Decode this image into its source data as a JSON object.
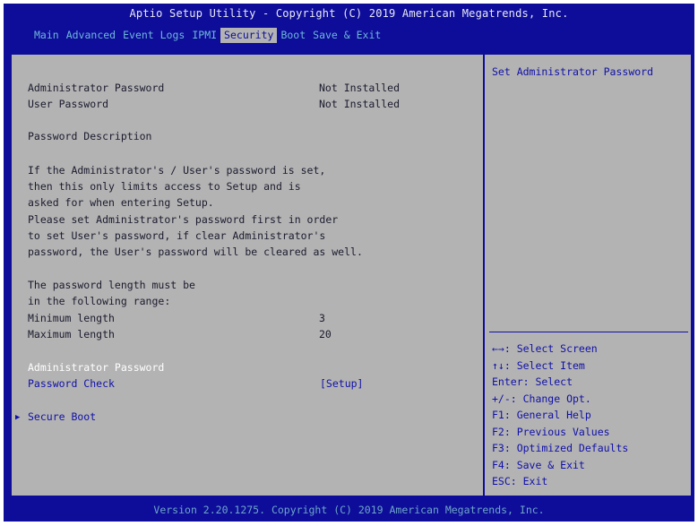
{
  "title": "Aptio Setup Utility - Copyright (C) 2019 American Megatrends, Inc.",
  "tabs": [
    "Main",
    "Advanced",
    "Event Logs",
    "IPMI",
    "Security",
    "Boot",
    "Save & Exit"
  ],
  "active_tab": "Security",
  "status": {
    "admin_label": "Administrator Password",
    "admin_value": "Not Installed",
    "user_label": "User Password",
    "user_value": "Not Installed"
  },
  "description": {
    "heading": "Password Description",
    "lines": [
      "If the Administrator's / User's password is set,",
      "then this only limits access to Setup and is",
      "asked for when entering Setup.",
      "Please set Administrator's password first in order",
      "to set User's password, if clear Administrator's",
      "password, the User's password will be cleared as well."
    ],
    "range_lines": [
      "The password length must be",
      "in the following range:"
    ],
    "min_label": "Minimum length",
    "min_value": "3",
    "max_label": "Maximum length",
    "max_value": "20"
  },
  "items": {
    "admin_password": "Administrator Password",
    "password_check": "Password Check",
    "password_check_value": "[Setup]",
    "secure_boot": "Secure Boot"
  },
  "help_text": "Set Administrator Password",
  "keys": [
    "←→: Select Screen",
    "↑↓: Select Item",
    "Enter: Select",
    "+/-: Change Opt.",
    "F1: General Help",
    "F2: Previous Values",
    "F3: Optimized Defaults",
    "F4: Save & Exit",
    "ESC: Exit"
  ],
  "footer": "Version 2.20.1275. Copyright (C) 2019 American Megatrends, Inc."
}
